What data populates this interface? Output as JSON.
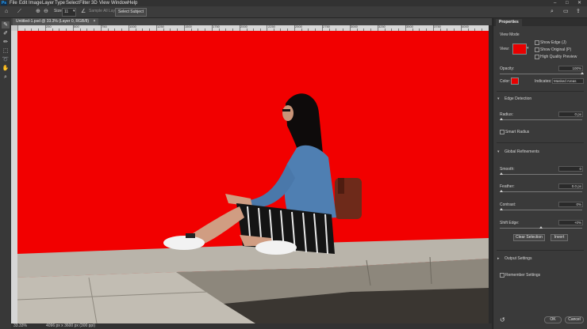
{
  "app": {
    "logo_text": "Ps"
  },
  "menu": [
    "File",
    "Edit",
    "Image",
    "Layer",
    "Type",
    "Select",
    "Filter",
    "3D",
    "View",
    "Window",
    "Help"
  ],
  "window_controls": [
    "–",
    "□",
    "✕"
  ],
  "options": {
    "size_label": "Size:",
    "size_value": "11",
    "sample_all_layers": "Sample All Layers",
    "select_subject": "Select Subject"
  },
  "document": {
    "tab_title": "Untitled-1.psd @ 33.3% (Layer 0, RGB/8)",
    "close_glyph": "×",
    "zoom": "33.33%",
    "dimensions": "4096 px x 3600 px (300 ppi)"
  },
  "ruler_labels": [
    "250",
    "500",
    "750",
    "1000",
    "1250",
    "1500",
    "1750",
    "2000",
    "2250",
    "2500",
    "2750",
    "3000",
    "3250",
    "3500",
    "3750",
    "4000"
  ],
  "properties": {
    "tab": "Properties",
    "view_mode_label": "View Mode",
    "view_label": "View:",
    "show_edge": "Show Edge (J)",
    "show_original": "Show Original (P)",
    "high_quality_preview": "High Quality Preview",
    "opacity_label": "Opacity:",
    "opacity_value": "100%",
    "opacity_level": 1.0,
    "color_label": "Color:",
    "indicates_label": "Indicates:",
    "indicates_value": "Masked Areas",
    "edge_detection": "Edge Detection",
    "radius_label": "Radius:",
    "radius_value": "0 px",
    "smart_radius": "Smart Radius",
    "global_refinements": "Global Refinements",
    "smooth_label": "Smooth:",
    "smooth_value": "0",
    "feather_label": "Feather:",
    "feather_value": "0.0 px",
    "contrast_label": "Contrast:",
    "contrast_value": "0%",
    "shift_edge_label": "Shift Edge:",
    "shift_edge_value": "+0%",
    "clear_selection": "Clear Selection",
    "invert": "Invert",
    "output_settings": "Output Settings",
    "remember_settings": "Remember Settings",
    "ok": "OK",
    "cancel": "Cancel"
  },
  "colors": {
    "overlay": "#f20000",
    "panel": "#3a3a3a",
    "accent": "#31a8ff"
  }
}
